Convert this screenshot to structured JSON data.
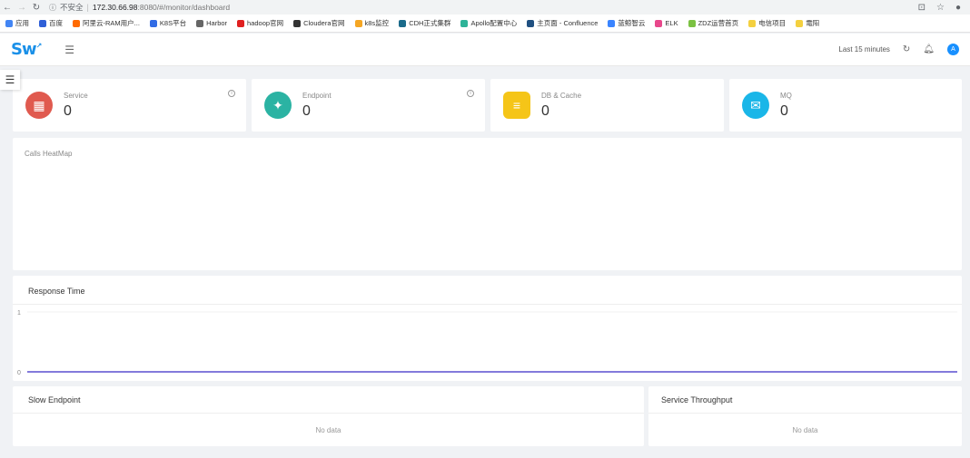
{
  "browser": {
    "insecure_label": "不安全",
    "url_host": "172.30.66.98",
    "url_path": ":8080/#/monitor/dashboard",
    "bookmarks": [
      {
        "label": "应用",
        "color": "#4285f4"
      },
      {
        "label": "百度",
        "color": "#2f5fd7"
      },
      {
        "label": "阿里云-RAM用户...",
        "color": "#ff6a00"
      },
      {
        "label": "K8S平台",
        "color": "#326ce5"
      },
      {
        "label": "Harbor",
        "color": "#666666"
      },
      {
        "label": "hadoop官网",
        "color": "#e02020"
      },
      {
        "label": "Cloudera官网",
        "color": "#333333"
      },
      {
        "label": "k8s监控",
        "color": "#f5a623"
      },
      {
        "label": "CDH正式集群",
        "color": "#1a6a8a"
      },
      {
        "label": "Apollo配置中心",
        "color": "#2eb398"
      },
      {
        "label": "主页面 - Confluence",
        "color": "#205081"
      },
      {
        "label": "蓝鲸智云",
        "color": "#3a84ff"
      },
      {
        "label": "ELK",
        "color": "#e8478b"
      },
      {
        "label": "ZDZ运营首页",
        "color": "#7bc142"
      },
      {
        "label": "电信项目",
        "color": "#f4d03f"
      },
      {
        "label": "電阳",
        "color": "#f4d03f"
      }
    ]
  },
  "header": {
    "logo": "Sw",
    "time_range": "Last 15 minutes",
    "avatar_initial": "A"
  },
  "stats": [
    {
      "label": "Service",
      "value": "0",
      "color": "#e05a4f",
      "icon": "grid-icon",
      "glyph": "▦",
      "info": true
    },
    {
      "label": "Endpoint",
      "value": "0",
      "color": "#2bb3a3",
      "icon": "share-icon",
      "glyph": "✦",
      "info": true
    },
    {
      "label": "DB & Cache",
      "value": "0",
      "color": "#f5c518",
      "icon": "database-icon",
      "glyph": "≡",
      "info": false
    },
    {
      "label": "MQ",
      "value": "0",
      "color": "#1ab6e8",
      "icon": "message-queue-icon",
      "glyph": "✉",
      "info": false
    }
  ],
  "heatmap": {
    "title": "Calls HeatMap"
  },
  "response_time": {
    "title": "Response Time",
    "chart_data": {
      "type": "line",
      "ylim": [
        0,
        1
      ],
      "yticks": [
        "1",
        "0"
      ],
      "series": [
        {
          "values": [
            0,
            0
          ],
          "color": "#5a4fcf"
        }
      ]
    }
  },
  "slow_endpoint": {
    "title": "Slow Endpoint",
    "empty": "No data"
  },
  "service_throughput": {
    "title": "Service Throughput",
    "empty": "No data"
  }
}
